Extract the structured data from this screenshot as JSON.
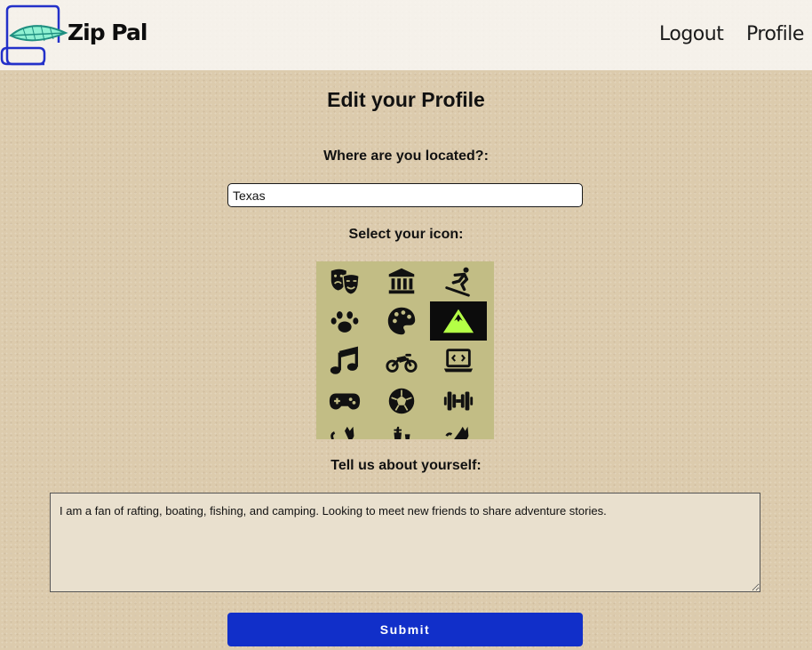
{
  "header": {
    "brand": "Zip Pal",
    "nav": {
      "logout": "Logout",
      "profile": "Profile"
    }
  },
  "page": {
    "title": "Edit your Profile"
  },
  "location": {
    "label": "Where are you located?:",
    "value": "Texas"
  },
  "icon_picker": {
    "label": "Select your icon:",
    "icons": [
      "theater-masks-icon",
      "landmark-icon",
      "snowboarding-icon",
      "paw-icon",
      "palette-icon",
      "mountain-icon",
      "music-icon",
      "motorcycle-icon",
      "laptop-code-icon",
      "gamepad-icon",
      "soccer-ball-icon",
      "dumbbell-icon",
      "cat-icon",
      "chess-icon",
      "cat-icon"
    ],
    "selected": "mountain-icon",
    "selected_color": "#b4ff46",
    "background_color": "#c2bd85"
  },
  "about": {
    "label": "Tell us about yourself:",
    "value": "I am a fan of rafting, boating, fishing, and camping. Looking to meet new friends to share adventure stories."
  },
  "submit": {
    "label": "Submit",
    "color": "#112fc9"
  }
}
